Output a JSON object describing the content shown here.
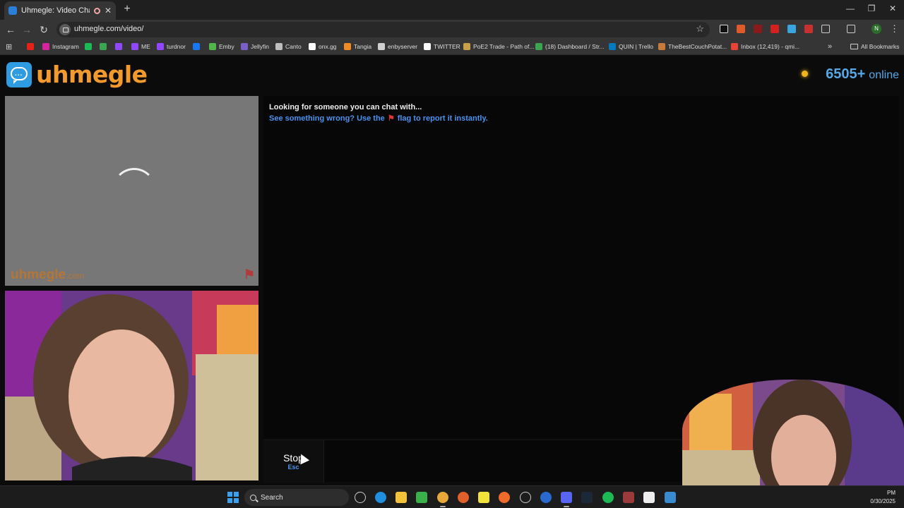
{
  "browser": {
    "tab": {
      "title": "Uhmegle: Video Chat | Ran"
    },
    "url": "uhmegle.com/video/",
    "bookmarks": [
      {
        "label": "",
        "icon": "youtube-icon",
        "color": "#e62117"
      },
      {
        "label": "Instagram",
        "icon": "instagram-icon",
        "color": "#d6249f"
      },
      {
        "label": "",
        "icon": "spotify-icon",
        "color": "#1db954"
      },
      {
        "label": "",
        "icon": "green-app-icon",
        "color": "#3aa650"
      },
      {
        "label": "",
        "icon": "twitch-icon",
        "color": "#9146ff"
      },
      {
        "label": "ME",
        "icon": "twitch-icon",
        "color": "#9146ff"
      },
      {
        "label": "turdnor",
        "icon": "twitch-icon",
        "color": "#9146ff"
      },
      {
        "label": "",
        "icon": "facebook-icon",
        "color": "#1877f2"
      },
      {
        "label": "Emby",
        "icon": "emby-icon",
        "color": "#52b54b"
      },
      {
        "label": "Jellyfin",
        "icon": "jellyfin-icon",
        "color": "#7b5fc9"
      },
      {
        "label": "Canto",
        "icon": "canto-icon",
        "color": "#bfbfbf"
      },
      {
        "label": "onx.gg",
        "icon": "onx-icon",
        "color": "#ffffff"
      },
      {
        "label": "Tangia",
        "icon": "tangia-icon",
        "color": "#f08a24"
      },
      {
        "label": "enbyserver",
        "icon": "globe-icon",
        "color": "#cfcfcf"
      },
      {
        "label": "TWITTER",
        "icon": "x-icon",
        "color": "#ffffff"
      },
      {
        "label": "PoE2 Trade - Path of...",
        "icon": "poe-icon",
        "color": "#c9a04a"
      },
      {
        "label": "(18) Dashboard / Str...",
        "icon": "dashboard-icon",
        "color": "#3aa650"
      },
      {
        "label": "QUIN | Trello",
        "icon": "trello-icon",
        "color": "#0079bf"
      },
      {
        "label": "TheBestCouchPotat...",
        "icon": "potato-icon",
        "color": "#c87a3a"
      },
      {
        "label": "Inbox (12,419) - qmi...",
        "icon": "gmail-icon",
        "color": "#ea4335"
      }
    ],
    "all_bookmarks_label": "All Bookmarks"
  },
  "site": {
    "logo_text": "uhmegle",
    "online_count": "6505+",
    "online_label": "online",
    "watermark_main": "uhmegle",
    "watermark_suffix": ".com"
  },
  "chat": {
    "status": "Looking for someone you can chat with...",
    "report_before": "See something wrong? Use the",
    "report_after": "flag to report it instantly."
  },
  "controls": {
    "stop_label": "Stop",
    "stop_key": "Esc"
  },
  "taskbar": {
    "search_label": "Search",
    "time": "PM",
    "date": "0/30/2025"
  },
  "colors": {
    "brand_orange": "#f29a2e",
    "link_blue": "#4b93f0",
    "online_blue": "#58a8e6"
  }
}
